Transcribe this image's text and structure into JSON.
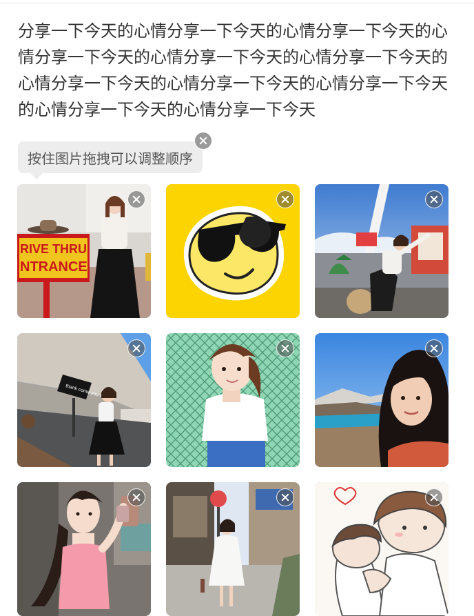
{
  "post": {
    "text": "分享一下今天的心情分享一下今天的心情分享一下今天的心情分享一下今天的心情分享一下今天的心情分享一下今天的心情分享一下今天的心情分享一下今天的心情分享一下今天的心情分享一下今天的心情分享一下今天"
  },
  "tooltip": {
    "text": "按住图片拖拽可以调整顺序"
  },
  "photos": [
    {
      "id": "photo-1",
      "icon": "close-icon"
    },
    {
      "id": "photo-2",
      "icon": "close-icon"
    },
    {
      "id": "photo-3",
      "icon": "close-icon"
    },
    {
      "id": "photo-4",
      "icon": "close-icon"
    },
    {
      "id": "photo-5",
      "icon": "close-icon"
    },
    {
      "id": "photo-6",
      "icon": "close-icon"
    },
    {
      "id": "photo-7",
      "icon": "close-icon"
    },
    {
      "id": "photo-8",
      "icon": "close-icon"
    },
    {
      "id": "photo-9",
      "icon": "close-icon"
    }
  ],
  "photo_text": {
    "sign_line_1": "RIVE THRU",
    "sign_line_2": "NTRANCE",
    "sign_small": "thank come\nyou again"
  },
  "colors": {
    "text": "#333333",
    "tooltip_bg": "#ededed",
    "tooltip_text": "#555555",
    "sticker_yellow": "#fcd401"
  }
}
